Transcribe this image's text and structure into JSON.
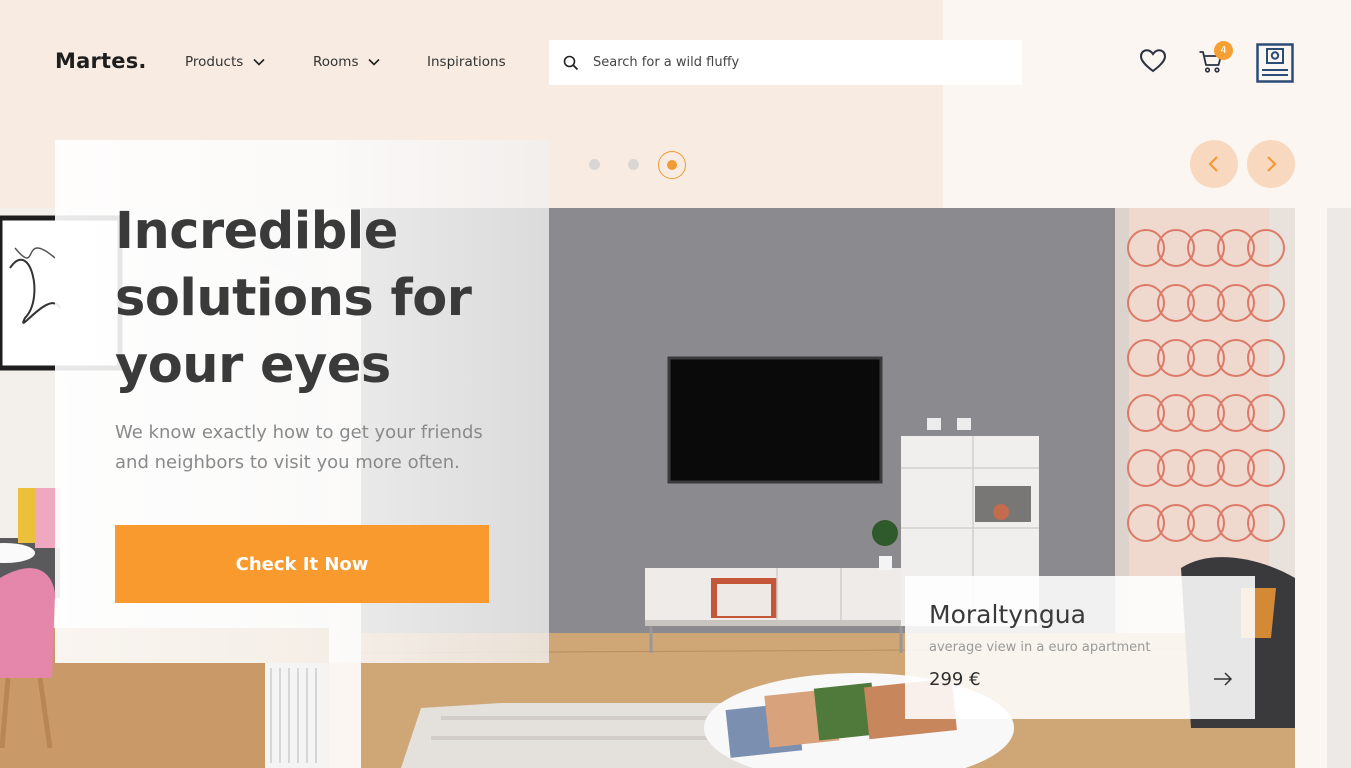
{
  "header": {
    "logo": "Martes.",
    "nav": [
      {
        "label": "Products",
        "has_dropdown": true
      },
      {
        "label": "Rooms",
        "has_dropdown": true
      },
      {
        "label": "Inspirations",
        "has_dropdown": false
      }
    ],
    "search": {
      "placeholder": "Search for a wild fluffy",
      "icon": "search-icon"
    },
    "icons": [
      "heart-icon",
      "cart-icon",
      "user-profile-icon"
    ],
    "cart_count": "4"
  },
  "slider": {
    "dot_count": 3,
    "active_index": 2,
    "prev_icon": "chevron-left-icon",
    "next_icon": "chevron-right-icon"
  },
  "hero": {
    "title": "Incredible solutions for your eyes",
    "subtitle": "We know exactly how to get your friends and neighbors to visit you more often.",
    "cta_label": "Check It Now"
  },
  "product": {
    "name": "Moraltyngua",
    "description": "average view in a euro apartment",
    "price": "299 €",
    "arrow_icon": "arrow-right-icon"
  },
  "colors": {
    "accent": "#f89a2e",
    "top_band": "#f8ece2",
    "page_bg": "#fbf6f1",
    "arrow_bg": "#f8d9c0",
    "profile_icon": "#2c4c78"
  }
}
